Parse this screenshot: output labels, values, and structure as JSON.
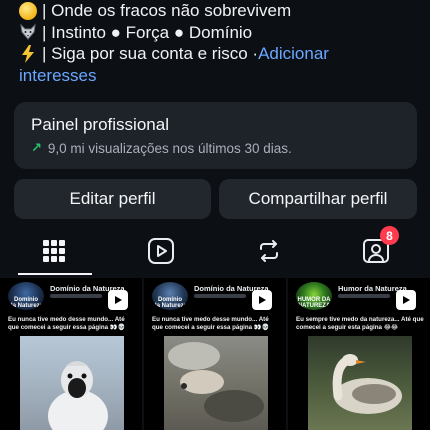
{
  "bio": {
    "lines": [
      {
        "emoji": "sun-emoji",
        "text": "| Onde os fracos não sobrevivem"
      },
      {
        "emoji": "wolf-emoji",
        "text": "| Instinto ● Força ● Domínio"
      },
      {
        "emoji": "lightning-emoji",
        "text": "| Siga por sua conta e risco · "
      }
    ],
    "link_part1": "Adicionar",
    "link_part2": "interesses"
  },
  "panel": {
    "title": "Painel profissional",
    "subtitle": "9,0 mi visualizações nos últimos 30 dias."
  },
  "buttons": {
    "edit": "Editar perfil",
    "share": "Compartilhar perfil"
  },
  "tabs": {
    "items": [
      {
        "name": "grid-icon",
        "active": true
      },
      {
        "name": "reels-icon",
        "active": false
      },
      {
        "name": "repost-icon",
        "active": false
      },
      {
        "name": "tagged-icon",
        "active": false
      }
    ],
    "badge_count": "8"
  },
  "grid": {
    "tiles": [
      {
        "title": "Domínio da Natureza",
        "logo_text_1": "Domínio",
        "logo_text_2": "da Natureza",
        "caption": "Eu nunca tive medo desse mundo... Até que comecei a seguir essa página 👀💀"
      },
      {
        "title": "Domínio da Natureza",
        "logo_text_1": "Domínio",
        "logo_text_2": "da Natureza",
        "caption": "Eu nunca tive medo desse mundo... Até que comecei a seguir essa página 👀💀"
      },
      {
        "title": "Humor da Natureza",
        "logo_text_1": "HUMOR DA",
        "logo_text_2": "NATUREZA",
        "caption": "Eu sempre tive medo da natureza... Até que comecei a seguir esta página 😂😂"
      }
    ]
  },
  "colors": {
    "background": "#0c0f14",
    "panel": "#1e2229",
    "button": "#22262d",
    "link": "#6aa7ff",
    "trend_green": "#27c26c",
    "badge": "#ff3b4d"
  }
}
